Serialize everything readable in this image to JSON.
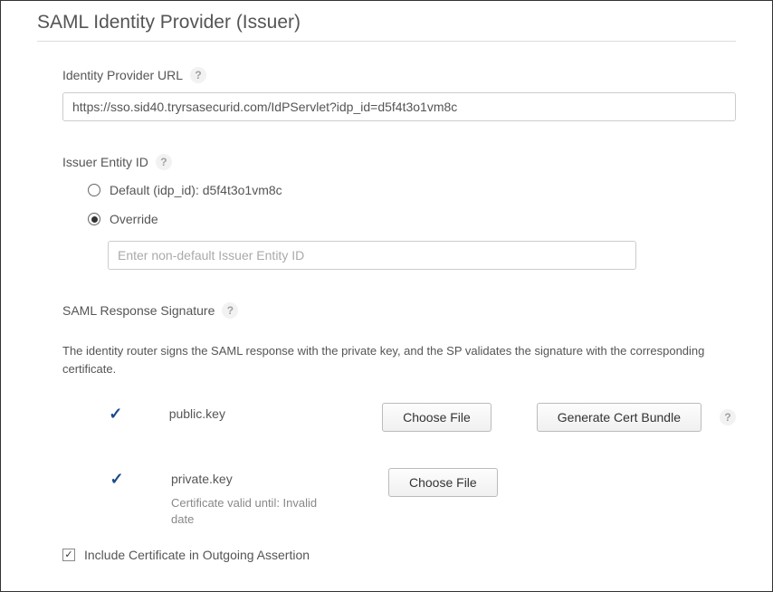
{
  "section_title": "SAML Identity Provider (Issuer)",
  "idp_url": {
    "label": "Identity Provider URL",
    "value": "https://sso.sid40.tryrsasecurid.com/IdPServlet?idp_id=d5f4t3o1vm8c"
  },
  "issuer": {
    "label": "Issuer Entity ID",
    "default_label": "Default (idp_id): d5f4t3o1vm8c",
    "override_label": "Override",
    "override_placeholder": "Enter non-default Issuer Entity ID",
    "override_value": ""
  },
  "signature": {
    "label": "SAML Response Signature",
    "description": "The identity router signs the SAML response with the private key, and the SP validates the signature with the corresponding certificate.",
    "public_key_name": "public.key",
    "private_key_name": "private.key",
    "choose_file_label": "Choose File",
    "generate_bundle_label": "Generate Cert Bundle",
    "cert_valid_text": "Certificate valid until: Invalid date"
  },
  "include_cert_label": "Include Certificate in Outgoing Assertion",
  "icons": {
    "help": "?",
    "check": "✓"
  }
}
